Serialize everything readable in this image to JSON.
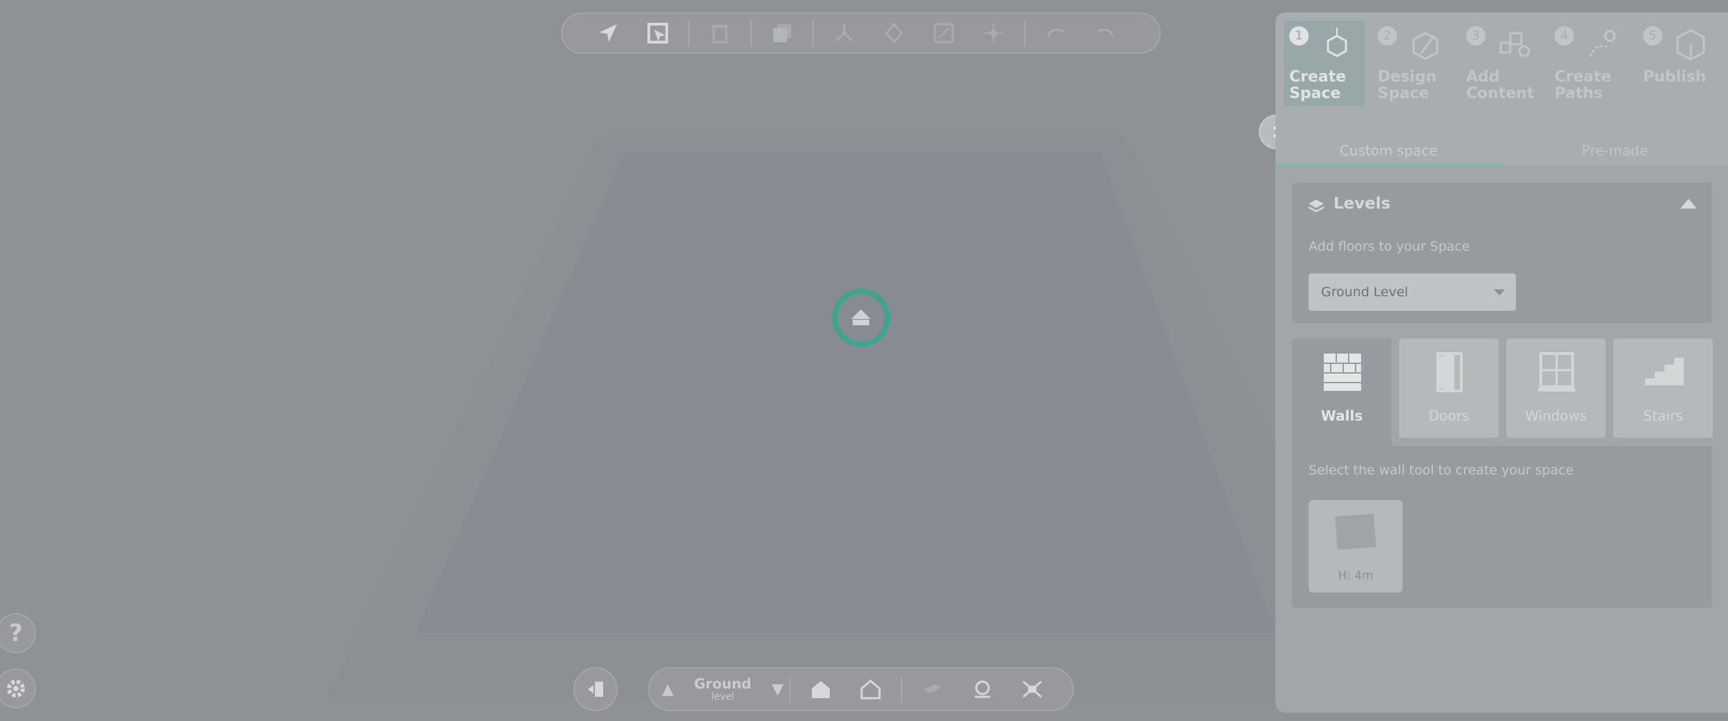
{
  "toolbar_top": {
    "buttons": [
      "select-arrow-icon",
      "select-area-icon",
      "delete-icon",
      "duplicate-icon",
      "move-nodes-icon",
      "rotate-icon",
      "scale-icon",
      "snap-icon",
      "undo-icon",
      "redo-icon"
    ]
  },
  "level_switcher": {
    "main": "Ground",
    "sub": "level",
    "up": "▲",
    "down": "▼"
  },
  "help_label": "?",
  "steps": [
    {
      "num": "1",
      "label_line1": "Create",
      "label_line2": "Space",
      "active": true
    },
    {
      "num": "2",
      "label_line1": "Design",
      "label_line2": "Space",
      "active": false
    },
    {
      "num": "3",
      "label_line1": "Add",
      "label_line2": "Content",
      "active": false
    },
    {
      "num": "4",
      "label_line1": "Create",
      "label_line2": "Paths",
      "active": false
    },
    {
      "num": "5",
      "label_line1": "Publish",
      "label_line2": "",
      "active": false
    }
  ],
  "tabs": {
    "custom": "Custom space",
    "premade": "Pre-made"
  },
  "levels": {
    "title": "Levels",
    "subtitle": "Add floors to your Space",
    "selected": "Ground Level"
  },
  "tools": {
    "walls": "Walls",
    "doors": "Doors",
    "windows": "Windows",
    "stairs": "Stairs",
    "hint": "Select the wall tool to create your space",
    "preset_label": "H: 4m"
  },
  "colors": {
    "accent": "#3fa48f",
    "background": "#8f9295",
    "floor": "#858b90"
  }
}
